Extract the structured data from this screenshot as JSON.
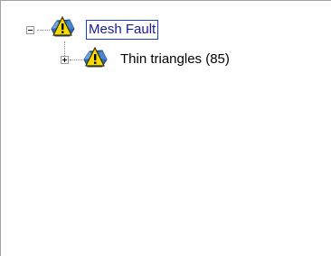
{
  "tree": {
    "root": {
      "label": "Mesh Fault",
      "expanded": true,
      "selected": true,
      "icon": "warning-mesh-icon"
    },
    "children": [
      {
        "label": "Thin triangles (85)",
        "expanded": false,
        "icon": "warning-mesh-icon"
      }
    ]
  },
  "colors": {
    "selection_border": "#1a3fd6",
    "warning_yellow": "#f5d90a",
    "mesh_blue": "#2e6db8"
  }
}
